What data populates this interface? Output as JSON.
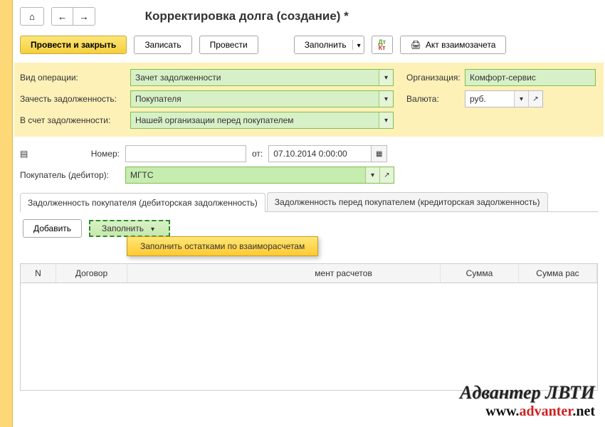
{
  "header": {
    "title": "Корректировка долга (создание) *"
  },
  "toolbar": {
    "post_and_close": "Провести и закрыть",
    "write": "Записать",
    "post": "Провести",
    "fill": "Заполнить",
    "act": "Акт взаимозачета"
  },
  "form": {
    "operation_type_label": "Вид операции:",
    "operation_type_value": "Зачет задолженности",
    "offset_debt_label": "Зачесть задолженность:",
    "offset_debt_value": "Покупателя",
    "against_debt_label": "В счет задолженности:",
    "against_debt_value": "Нашей организации перед покупателем",
    "org_label": "Организация:",
    "org_value": "Комфорт-сервис",
    "currency_label": "Валюта:",
    "currency_value": "руб.",
    "number_label": "Номер:",
    "number_value": "",
    "date_label": "от:",
    "date_value": "07.10.2014  0:00:00",
    "buyer_label": "Покупатель (дебитор):",
    "buyer_value": "МГТС"
  },
  "tabs": {
    "tab1": "Задолженность покупателя (дебиторская задолженность)",
    "tab2": "Задолженность перед покупателем (кредиторская задолженность)"
  },
  "subtoolbar": {
    "add": "Добавить",
    "fill": "Заполнить"
  },
  "popup": {
    "fill_balances": "Заполнить остатками по взаиморасчетам"
  },
  "table": {
    "col_n": "N",
    "col_contract": "Договор",
    "col_docsettle": "мент расчетов",
    "col_sum": "Сумма",
    "col_sumsettle": "Сумма рас"
  },
  "watermark": {
    "brand": "Адвантер ЛВТИ",
    "www": "www.",
    "domain_red": "advanter",
    "tld": ".net"
  }
}
